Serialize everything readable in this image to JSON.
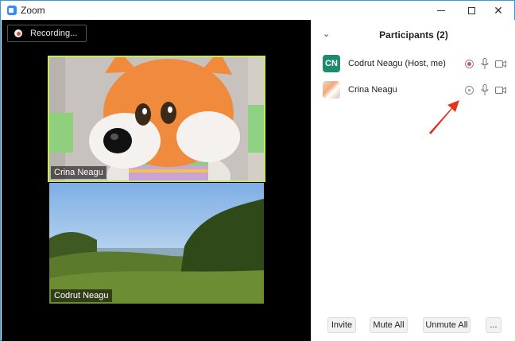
{
  "window": {
    "title": "Zoom",
    "icon": "zoom-logo-icon",
    "controls": [
      "minimize-icon",
      "maximize-icon",
      "close-icon"
    ],
    "close_glyph": "✕",
    "accent": "#2d8cff"
  },
  "video": {
    "recording_label": "Recording...",
    "tiles": [
      {
        "name": "Crina Neagu",
        "active_speaker": true,
        "border_color": "#c6e86a"
      },
      {
        "name": "Codrut Neagu",
        "active_speaker": false
      }
    ]
  },
  "participants": {
    "collapse_glyph": "⌄",
    "title": "Participants (2)",
    "list": [
      {
        "initials": "CN",
        "name": "Codrut Neagu (Host, me)",
        "avatar_color": "#1f8a6d",
        "recording": true
      },
      {
        "initials": "",
        "name": "Crina Neagu",
        "avatar_color": "",
        "recording": false
      }
    ],
    "footer": {
      "invite_label": "Invite",
      "mute_all_label": "Mute All",
      "unmute_all_label": "Unmute All",
      "more_label": "..."
    }
  },
  "colors": {
    "recording_dot": "#d9534f",
    "annotation_arrow": "#e3341f"
  }
}
